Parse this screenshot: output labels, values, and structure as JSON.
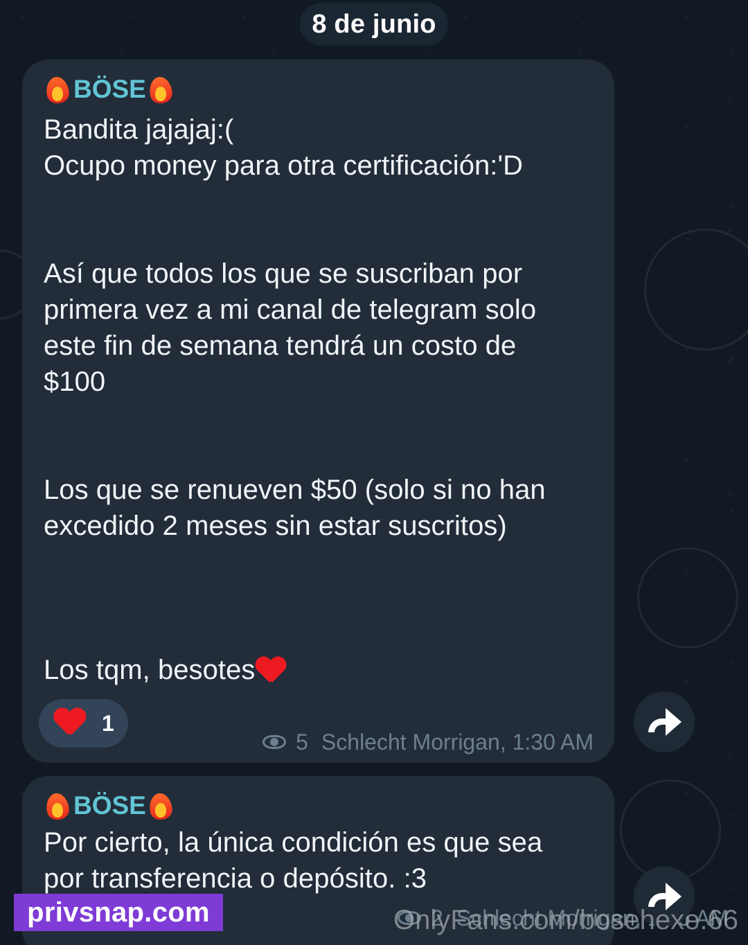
{
  "date_separator": "8 de junio",
  "messages": [
    {
      "sender": "BÖSE",
      "text": "Bandita jajajaj:(\nOcupo money para otra certificación:'D\n\n\nAsí que todos los que se suscriban por\nprimera vez a mi canal de telegram solo\neste fin de semana tendrá un costo de\n$100\n\n\nLos que se renueven $50 (solo si no han\nexcedido 2 meses sin estar suscritos)\n\n\n\nLos tqm, besotes",
      "reaction_count": "1",
      "views": "5",
      "author_time": "Schlecht Morrigan, 1:30 AM"
    },
    {
      "sender": "BÖSE",
      "text": "Por cierto, la única condición es que sea\npor transferencia o depósito. :3",
      "views": "2",
      "author_time": "Schlecht Morrigan, 1:35 AM"
    }
  ],
  "watermarks": {
    "left": "privsnap.com",
    "right": "OnlyFans.com/bosehexe.66"
  },
  "icons": {
    "sender_decoration": "fire-icon",
    "inline_emoji": "red-heart-icon",
    "reaction": "red-heart-icon",
    "views": "eye-icon",
    "forward": "forward-arrow-icon"
  },
  "colors": {
    "background": "#111a24",
    "bubble": "#222d39",
    "sender": "#62c4d4",
    "meta": "#6d7f8f",
    "reaction_bg": "#334458",
    "watermark_left": "#7e3bd6"
  }
}
